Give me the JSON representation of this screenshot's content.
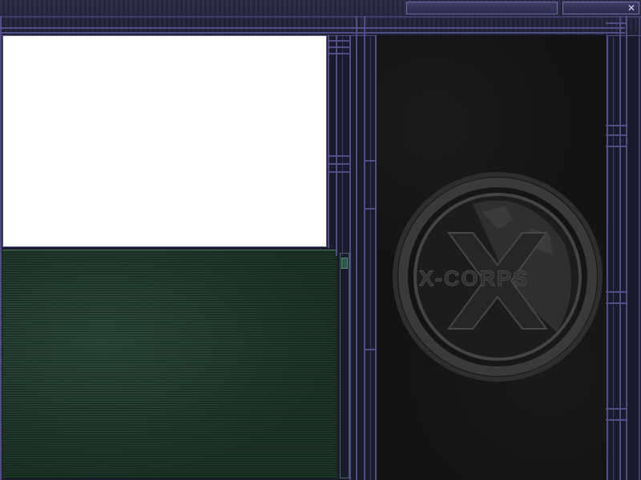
{
  "titlebar": {
    "close_glyph": "✕"
  },
  "logo": {
    "text": "X-CORPS",
    "icon": "x-corps-globe-emblem"
  },
  "colors": {
    "frame": "#4f4f86",
    "frame_dark": "#1b1b2e",
    "detail_panel": "#ffffff",
    "list_panel": "#1d3429",
    "emblem_panel": "#121214"
  }
}
